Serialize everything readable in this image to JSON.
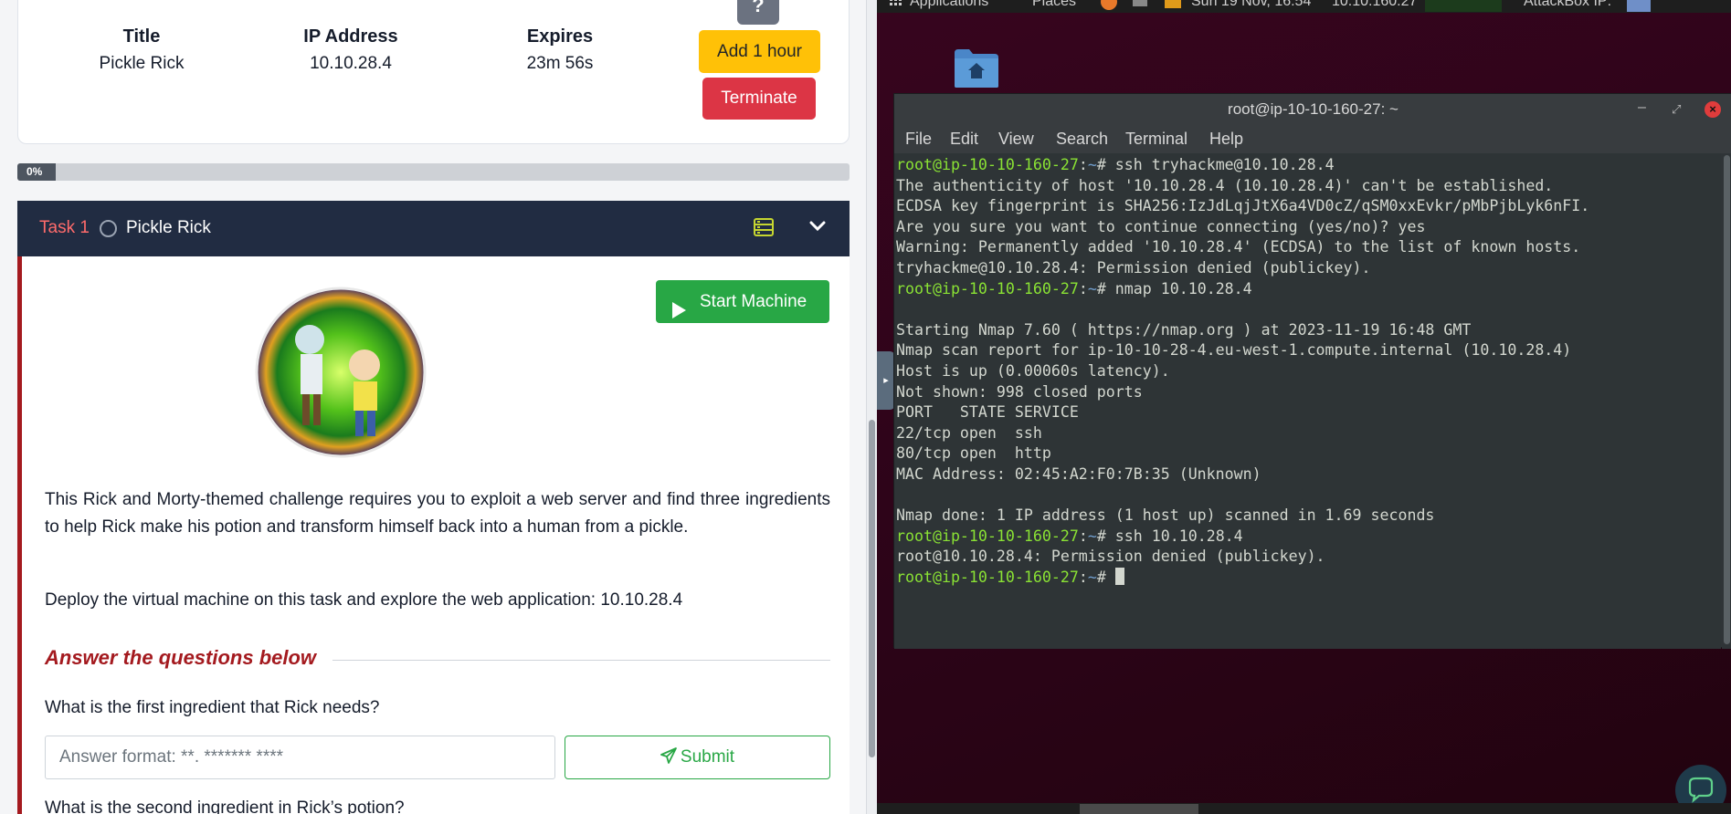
{
  "machine": {
    "title_header": "Title",
    "title_value": "Pickle Rick",
    "ip_header": "IP Address",
    "ip_value": "10.10.28.4",
    "expires_header": "Expires",
    "expires_value": "23m 56s",
    "help_label": "?",
    "add_hour_label": "Add 1 hour",
    "terminate_label": "Terminate"
  },
  "progress": {
    "label": "0%",
    "value": 0
  },
  "task": {
    "number": "Task 1",
    "title": "Pickle Rick",
    "start_label": "Start Machine",
    "description": "This Rick and Morty-themed challenge requires you to exploit a web server and find three ingredients to help Rick make his potion and transform himself back into a human from a pickle.",
    "deploy_text": "Deploy the virtual machine on this task and explore the web application: 10.10.28.4",
    "answer_heading": "Answer the questions below",
    "question1": "What is the first ingredient that Rick needs?",
    "answer_placeholder": "Answer format: **. ******* ****",
    "submit_label": "Submit",
    "question2": "What is the second ingredient in Rick’s potion?"
  },
  "desktop": {
    "topbar": {
      "applications": "Applications",
      "places": "Places",
      "datetime": "Sun 19 Nov, 16:54",
      "ip_text": "10.10.160.27",
      "attackbox": "AttackBox IP:"
    },
    "terminal": {
      "title": "root@ip-10-10-160-27: ~",
      "menu": [
        "File",
        "Edit",
        "View",
        "Search",
        "Terminal",
        "Help"
      ],
      "lines": [
        {
          "prompt": "root@ip-10-10-160-27",
          "path": "~",
          "cmd": "ssh tryhackme@10.10.28.4"
        },
        {
          "text": "The authenticity of host '10.10.28.4 (10.10.28.4)' can't be established."
        },
        {
          "text": "ECDSA key fingerprint is SHA256:IzJdLqjJtX6a4VD0cZ/qSM0xxEvkr/pMbPjbLyk6nFI."
        },
        {
          "text": "Are you sure you want to continue connecting (yes/no)? yes"
        },
        {
          "text": "Warning: Permanently added '10.10.28.4' (ECDSA) to the list of known hosts."
        },
        {
          "text": "tryhackme@10.10.28.4: Permission denied (publickey)."
        },
        {
          "prompt": "root@ip-10-10-160-27",
          "path": "~",
          "cmd": "nmap 10.10.28.4"
        },
        {
          "text": ""
        },
        {
          "text": "Starting Nmap 7.60 ( https://nmap.org ) at 2023-11-19 16:48 GMT"
        },
        {
          "text": "Nmap scan report for ip-10-10-28-4.eu-west-1.compute.internal (10.10.28.4)"
        },
        {
          "text": "Host is up (0.00060s latency)."
        },
        {
          "text": "Not shown: 998 closed ports"
        },
        {
          "text": "PORT   STATE SERVICE"
        },
        {
          "text": "22/tcp open  ssh"
        },
        {
          "text": "80/tcp open  http"
        },
        {
          "text": "MAC Address: 02:45:A2:F0:7B:35 (Unknown)"
        },
        {
          "text": ""
        },
        {
          "text": "Nmap done: 1 IP address (1 host up) scanned in 1.69 seconds"
        },
        {
          "prompt": "root@ip-10-10-160-27",
          "path": "~",
          "cmd": "ssh 10.10.28.4"
        },
        {
          "text": "root@10.10.28.4: Permission denied (publickey)."
        },
        {
          "prompt": "root@ip-10-10-160-27",
          "path": "~",
          "cmd": "",
          "cursor": true
        }
      ]
    }
  },
  "colors": {
    "accent_red": "#a41a1f",
    "start_green": "#28a745",
    "add_hour_yellow": "#ffc107",
    "terminate_red": "#dc3545",
    "task_header_bg": "#212c42",
    "terminal_prompt": "#8ae234",
    "terminal_path": "#729fcf",
    "desktop_bg": "#2c0418"
  }
}
